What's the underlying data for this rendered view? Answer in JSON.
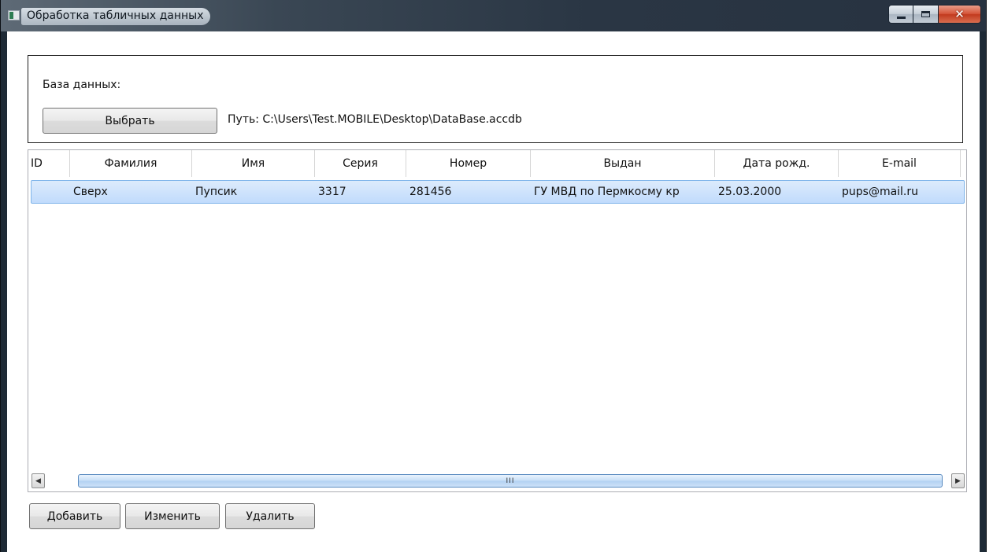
{
  "window": {
    "title": "Обработка табличных данных",
    "controls": {
      "minimize": "minimize-icon",
      "maximize": "maximize-icon",
      "close": "close-icon"
    }
  },
  "database": {
    "label": "База данных:",
    "choose_button": "Выбрать",
    "path": "Путь: C:\\Users\\Test.MOBILE\\Desktop\\DataBase.accdb"
  },
  "grid": {
    "columns": [
      "ID",
      "Фамилия",
      "Имя",
      "Серия",
      "Номер",
      "Выдан",
      "Дата рожд.",
      "E-mail"
    ],
    "rows": [
      [
        "",
        "Сверх",
        "Пупсик",
        "3317",
        "281456",
        "ГУ МВД по Пермкосму кр",
        "25.03.2000",
        "pups@mail.ru"
      ]
    ],
    "selected_row": 0,
    "scroll_grip": "III"
  },
  "actions": {
    "add": "Добавить",
    "edit": "Изменить",
    "delete": "Удалить"
  },
  "colors": {
    "selection": "#c1dbfc",
    "close_button": "#c23a1e",
    "titlebar": "#2a3644"
  }
}
